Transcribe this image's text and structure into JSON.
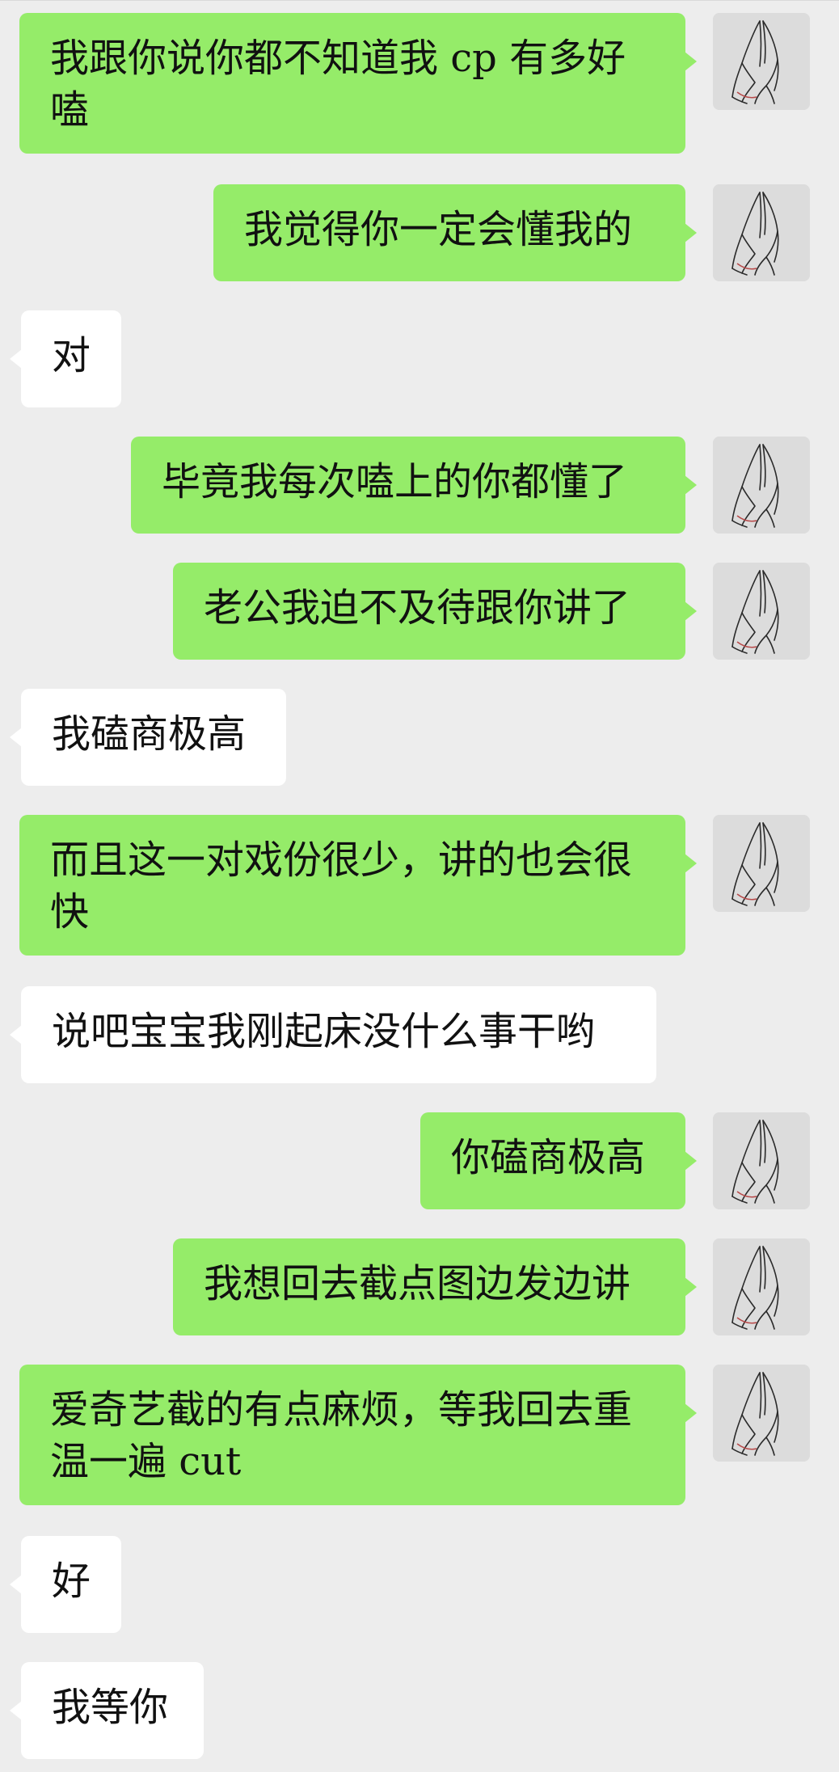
{
  "messages": [
    {
      "side": "out",
      "lines": [
        "我跟你说你都不知道我 cp 有多好",
        "嗑"
      ]
    },
    {
      "side": "out",
      "lines": [
        "我觉得你一定会懂我的"
      ]
    },
    {
      "side": "in",
      "lines": [
        "对"
      ]
    },
    {
      "side": "out",
      "lines": [
        "毕竟我每次嗑上的你都懂了"
      ]
    },
    {
      "side": "out",
      "lines": [
        "老公我迫不及待跟你讲了"
      ]
    },
    {
      "side": "in",
      "lines": [
        "我磕商极高"
      ]
    },
    {
      "side": "out",
      "lines": [
        "而且这一对戏份很少，讲的也会很",
        "快"
      ]
    },
    {
      "side": "in",
      "lines": [
        "说吧宝宝我刚起床没什么事干哟"
      ]
    },
    {
      "side": "out",
      "lines": [
        "你磕商极高"
      ]
    },
    {
      "side": "out",
      "lines": [
        "我想回去截点图边发边讲"
      ]
    },
    {
      "side": "out",
      "lines": [
        "爱奇艺截的有点麻烦，等我回去重",
        "温一遍 cut"
      ]
    },
    {
      "side": "in",
      "lines": [
        "好"
      ]
    },
    {
      "side": "in",
      "lines": [
        "我等你"
      ]
    }
  ],
  "self_avatar_icon": "praying-hands-icon",
  "colors": {
    "background": "#ededed",
    "outgoing_bubble": "#95ec69",
    "incoming_bubble": "#ffffff"
  }
}
